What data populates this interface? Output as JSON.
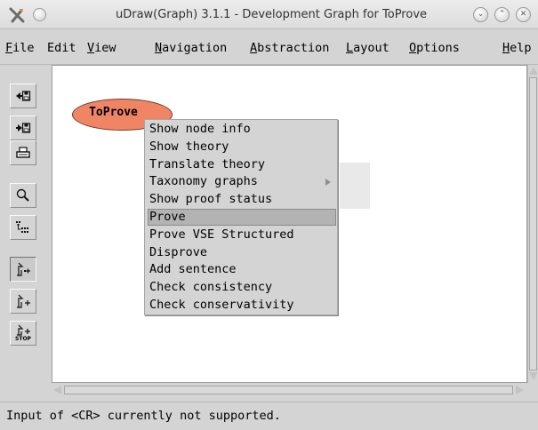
{
  "window": {
    "title": "uDraw(Graph) 3.1.1 - Development Graph for ToProve",
    "app_icon": "udraw-x-icon",
    "buttons": {
      "minimize": "⌄",
      "maximize": "⌃",
      "close": "✕"
    }
  },
  "menubar": [
    {
      "mnemonic": "F",
      "rest": "ile"
    },
    {
      "mnemonic": "",
      "rest": "Edit"
    },
    {
      "mnemonic": "V",
      "rest": "iew"
    },
    {
      "mnemonic": "N",
      "rest": "avigation"
    },
    {
      "mnemonic": "A",
      "rest": "bstraction"
    },
    {
      "mnemonic": "L",
      "rest": "ayout"
    },
    {
      "mnemonic": "O",
      "rest": "ptions"
    },
    {
      "mnemonic": "H",
      "rest": "elp"
    }
  ],
  "toolbar": [
    {
      "icon": "load-graph-icon",
      "pressed": false
    },
    {
      "icon": "save-graph-icon",
      "pressed": false
    },
    {
      "icon": "print-icon",
      "pressed": false
    },
    {
      "icon": "zoom-icon",
      "pressed": false
    },
    {
      "icon": "layout-graph-icon",
      "pressed": false
    },
    {
      "icon": "edge-mode-icon",
      "pressed": true
    },
    {
      "icon": "edge-mode-alt-icon",
      "pressed": false
    },
    {
      "icon": "stop-icon",
      "pressed": false,
      "label": "STOP"
    }
  ],
  "node": {
    "label": "ToProve",
    "fill": "#f08566"
  },
  "context_menu": {
    "items": [
      {
        "label": "Show node info",
        "selected": false,
        "submenu": false
      },
      {
        "label": "Show theory",
        "selected": false,
        "submenu": false
      },
      {
        "label": "Translate theory",
        "selected": false,
        "submenu": false
      },
      {
        "label": "Taxonomy graphs",
        "selected": false,
        "submenu": true
      },
      {
        "label": "Show proof status",
        "selected": false,
        "submenu": false
      },
      {
        "label": "Prove",
        "selected": true,
        "submenu": false
      },
      {
        "label": "Prove VSE Structured",
        "selected": false,
        "submenu": false
      },
      {
        "label": "Disprove",
        "selected": false,
        "submenu": false
      },
      {
        "label": "Add sentence",
        "selected": false,
        "submenu": false
      },
      {
        "label": "Check consistency",
        "selected": false,
        "submenu": false
      },
      {
        "label": "Check conservativity",
        "selected": false,
        "submenu": false
      }
    ]
  },
  "status": {
    "text": "Input of <CR> currently not supported."
  }
}
